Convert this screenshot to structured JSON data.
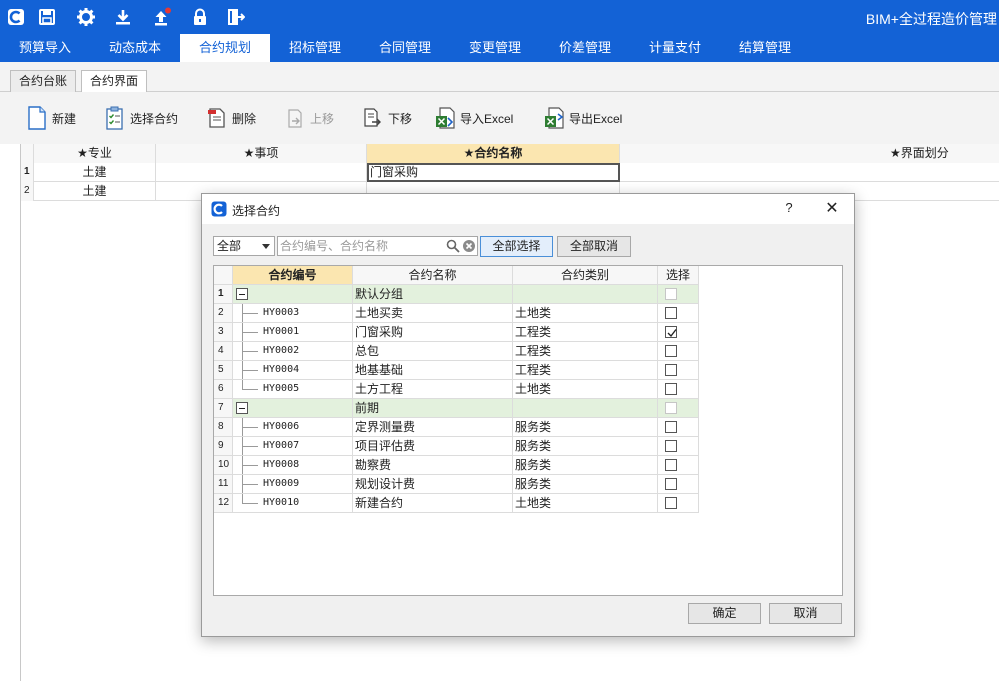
{
  "app": {
    "title": "BIM+全过程造价管理"
  },
  "main_tabs": [
    "预算导入",
    "动态成本",
    "合约规划",
    "招标管理",
    "合同管理",
    "变更管理",
    "价差管理",
    "计量支付",
    "结算管理"
  ],
  "sub_tabs": [
    "合约台账",
    "合约界面"
  ],
  "toolbar": {
    "new": "新建",
    "select_contract": "选择合约",
    "delete": "删除",
    "move_up": "上移",
    "move_down": "下移",
    "import_excel": "导入Excel",
    "export_excel": "导出Excel"
  },
  "main_grid": {
    "headers": [
      "★专业",
      "★事项",
      "★合约名称",
      "★界面划分"
    ],
    "rows": [
      {
        "num": "1",
        "specialty": "土建",
        "item": "",
        "contract_name": "门窗采购",
        "division": ""
      },
      {
        "num": "2",
        "specialty": "土建",
        "item": "",
        "contract_name": "",
        "division": ""
      }
    ]
  },
  "dialog": {
    "title": "选择合约",
    "help": "?",
    "close": "✕",
    "filter_value": "全部",
    "search_placeholder": "合约编号、合约名称",
    "select_all": "全部选择",
    "deselect_all": "全部取消",
    "ok": "确定",
    "cancel": "取消",
    "grid": {
      "headers": [
        "合约编号",
        "合约名称",
        "合约类别",
        "选择"
      ],
      "rows": [
        {
          "num": "1",
          "group": true,
          "code": "",
          "name": "默认分组",
          "category": "",
          "checked": false
        },
        {
          "num": "2",
          "group": false,
          "code": "HY0003",
          "name": "土地买卖",
          "category": "土地类",
          "checked": false
        },
        {
          "num": "3",
          "group": false,
          "code": "HY0001",
          "name": "门窗采购",
          "category": "工程类",
          "checked": true
        },
        {
          "num": "4",
          "group": false,
          "code": "HY0002",
          "name": "总包",
          "category": "工程类",
          "checked": false
        },
        {
          "num": "5",
          "group": false,
          "code": "HY0004",
          "name": "地基基础",
          "category": "工程类",
          "checked": false
        },
        {
          "num": "6",
          "group": false,
          "code": "HY0005",
          "name": "土方工程",
          "category": "土地类",
          "checked": false
        },
        {
          "num": "7",
          "group": true,
          "code": "",
          "name": "前期",
          "category": "",
          "checked": false
        },
        {
          "num": "8",
          "group": false,
          "code": "HY0006",
          "name": "定界测量费",
          "category": "服务类",
          "checked": false
        },
        {
          "num": "9",
          "group": false,
          "code": "HY0007",
          "name": "项目评估费",
          "category": "服务类",
          "checked": false
        },
        {
          "num": "10",
          "group": false,
          "code": "HY0008",
          "name": "勘察费",
          "category": "服务类",
          "checked": false
        },
        {
          "num": "11",
          "group": false,
          "code": "HY0009",
          "name": "规划设计费",
          "category": "服务类",
          "checked": false
        },
        {
          "num": "12",
          "group": false,
          "code": "HY0010",
          "name": "新建合约",
          "category": "土地类",
          "checked": false
        }
      ]
    }
  },
  "colors": {
    "brand_blue": "#1362d6",
    "header_highlight": "#fbe6b0",
    "group_row": "#e3f1dd"
  }
}
